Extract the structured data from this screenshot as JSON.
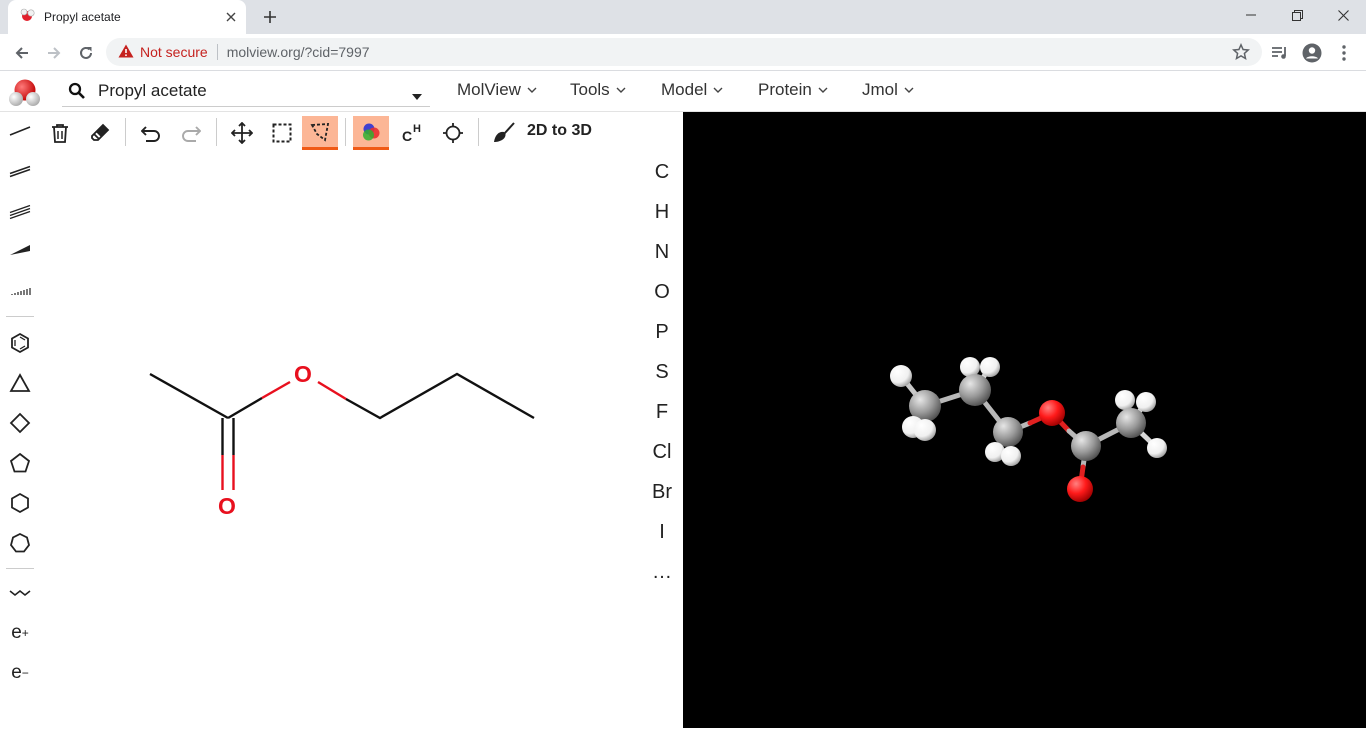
{
  "browser": {
    "tab_title": "Propyl acetate",
    "security_label": "Not secure",
    "url": "molview.org/?cid=7997"
  },
  "app": {
    "search_value": "Propyl acetate",
    "menus": [
      "MolView",
      "Tools",
      "Model",
      "Protein",
      "Jmol"
    ]
  },
  "toolbar": {
    "convert_label": "2D to 3D",
    "active_tools": [
      "lasso-select",
      "color-mode"
    ]
  },
  "left_tools": {
    "charge_plus": "e",
    "charge_plus_sup": "+",
    "charge_minus": "e",
    "charge_minus_sup": "−"
  },
  "elements": [
    "C",
    "H",
    "N",
    "O",
    "P",
    "S",
    "F",
    "Cl",
    "Br",
    "I",
    "…"
  ],
  "structure": {
    "oxygen_label_1": "O",
    "oxygen_label_2": "O",
    "oxygen_color": "#e8101e"
  },
  "colors": {
    "accent": "#f05a16",
    "active_bg": "#fcb696",
    "viewer_bg": "#000000",
    "atom_carbon": "#909090",
    "atom_hydrogen": "#ffffff",
    "atom_oxygen": "#ff0d0d"
  }
}
